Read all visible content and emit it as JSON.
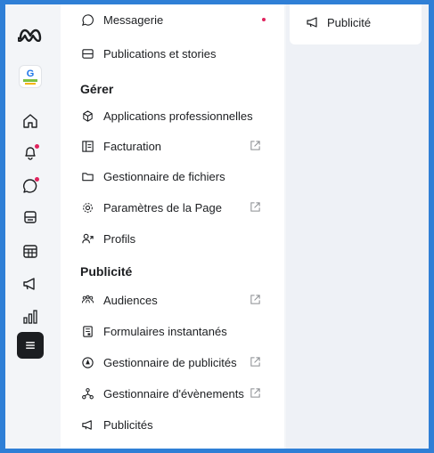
{
  "rail": {
    "icons": [
      "meta-logo",
      "brand-avatar",
      "home-icon",
      "notifications-icon",
      "chat-icon",
      "posts-icon",
      "calendar-icon",
      "ads-megaphone-icon",
      "insights-icon",
      "menu-icon"
    ]
  },
  "menu": {
    "items_top": [
      {
        "label": "Messagerie",
        "icon": "chat-bubble-icon",
        "badge": true
      },
      {
        "label": "Publications et stories",
        "icon": "posts-icon"
      }
    ],
    "section_manage": "Gérer",
    "items_manage": [
      {
        "label": "Applications professionnelles",
        "icon": "cube-icon",
        "external": false
      },
      {
        "label": "Facturation",
        "icon": "billing-icon",
        "external": true
      },
      {
        "label": "Gestionnaire de fichiers",
        "icon": "folder-icon",
        "external": false
      },
      {
        "label": "Paramètres de la Page",
        "icon": "gear-icon",
        "external": true
      },
      {
        "label": "Profils",
        "icon": "profile-icon",
        "external": false
      }
    ],
    "section_ads": "Publicité",
    "items_ads": [
      {
        "label": "Audiences",
        "icon": "audiences-icon",
        "external": true
      },
      {
        "label": "Formulaires instantanés",
        "icon": "form-icon",
        "external": false
      },
      {
        "label": "Gestionnaire de publicités",
        "icon": "ads-manager-icon",
        "external": true
      },
      {
        "label": "Gestionnaire d'évènements",
        "icon": "events-icon",
        "external": true
      },
      {
        "label": "Publicités",
        "icon": "megaphone-icon",
        "external": false
      }
    ]
  },
  "card": {
    "label": "Publicité"
  },
  "colors": {
    "frame_border": "#2f7fd6",
    "active_rail": "#1c1e21",
    "badge": "#e0245e"
  }
}
